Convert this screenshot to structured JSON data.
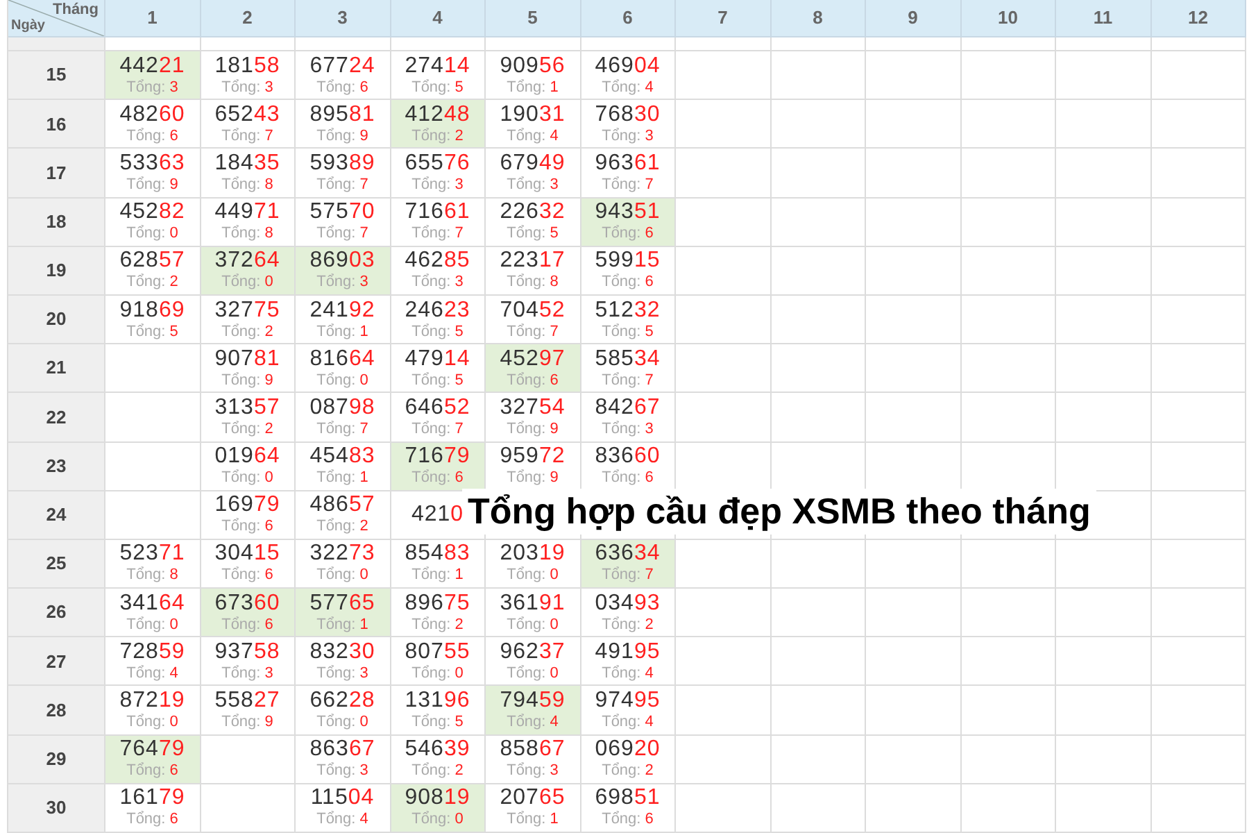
{
  "corner": {
    "column_label": "Tháng",
    "row_label": "Ngày"
  },
  "months": [
    "1",
    "2",
    "3",
    "4",
    "5",
    "6",
    "7",
    "8",
    "9",
    "10",
    "11",
    "12"
  ],
  "rows": [
    {
      "day": "15",
      "cells": [
        {
          "number": "44221",
          "total": "Tổng: 3",
          "highlighted": true
        },
        {
          "number": "18158",
          "total": "Tổng: 3",
          "highlighted": false
        },
        {
          "number": "67724",
          "total": "Tổng: 6",
          "highlighted": false
        },
        {
          "number": "27414",
          "total": "Tổng: 5",
          "highlighted": false
        },
        {
          "number": "90956",
          "total": "Tổng: 1",
          "highlighted": false
        },
        {
          "number": "46904",
          "total": "Tổng: 4",
          "highlighted": false
        }
      ]
    },
    {
      "day": "16",
      "cells": [
        {
          "number": "48260",
          "total": "Tổng: 6",
          "highlighted": false
        },
        {
          "number": "65243",
          "total": "Tổng: 7",
          "highlighted": false
        },
        {
          "number": "89581",
          "total": "Tổng: 9",
          "highlighted": false
        },
        {
          "number": "41248",
          "total": "Tổng: 2",
          "highlighted": true
        },
        {
          "number": "19031",
          "total": "Tổng: 4",
          "highlighted": false
        },
        {
          "number": "76830",
          "total": "Tổng: 3",
          "highlighted": false
        }
      ]
    },
    {
      "day": "17",
      "cells": [
        {
          "number": "53363",
          "total": "Tổng: 9",
          "highlighted": false
        },
        {
          "number": "18435",
          "total": "Tổng: 8",
          "highlighted": false
        },
        {
          "number": "59389",
          "total": "Tổng: 7",
          "highlighted": false
        },
        {
          "number": "65576",
          "total": "Tổng: 3",
          "highlighted": false
        },
        {
          "number": "67949",
          "total": "Tổng: 3",
          "highlighted": false
        },
        {
          "number": "96361",
          "total": "Tổng: 7",
          "highlighted": false
        }
      ]
    },
    {
      "day": "18",
      "cells": [
        {
          "number": "45282",
          "total": "Tổng: 0",
          "highlighted": false
        },
        {
          "number": "44971",
          "total": "Tổng: 8",
          "highlighted": false
        },
        {
          "number": "57570",
          "total": "Tổng: 7",
          "highlighted": false
        },
        {
          "number": "71661",
          "total": "Tổng: 7",
          "highlighted": false
        },
        {
          "number": "22632",
          "total": "Tổng: 5",
          "highlighted": false
        },
        {
          "number": "94351",
          "total": "Tổng: 6",
          "highlighted": true
        }
      ]
    },
    {
      "day": "19",
      "cells": [
        {
          "number": "62857",
          "total": "Tổng: 2",
          "highlighted": false
        },
        {
          "number": "37264",
          "total": "Tổng: 0",
          "highlighted": true
        },
        {
          "number": "86903",
          "total": "Tổng: 3",
          "highlighted": true
        },
        {
          "number": "46285",
          "total": "Tổng: 3",
          "highlighted": false
        },
        {
          "number": "22317",
          "total": "Tổng: 8",
          "highlighted": false
        },
        {
          "number": "59915",
          "total": "Tổng: 6",
          "highlighted": false
        }
      ]
    },
    {
      "day": "20",
      "cells": [
        {
          "number": "91869",
          "total": "Tổng: 5",
          "highlighted": false
        },
        {
          "number": "32775",
          "total": "Tổng: 2",
          "highlighted": false
        },
        {
          "number": "24192",
          "total": "Tổng: 1",
          "highlighted": false
        },
        {
          "number": "24623",
          "total": "Tổng: 5",
          "highlighted": false
        },
        {
          "number": "70452",
          "total": "Tổng: 7",
          "highlighted": false
        },
        {
          "number": "51232",
          "total": "Tổng: 5",
          "highlighted": false
        }
      ]
    },
    {
      "day": "21",
      "cells": [
        null,
        {
          "number": "90781",
          "total": "Tổng: 9",
          "highlighted": false
        },
        {
          "number": "81664",
          "total": "Tổng: 0",
          "highlighted": false
        },
        {
          "number": "47914",
          "total": "Tổng: 5",
          "highlighted": false
        },
        {
          "number": "45297",
          "total": "Tổng: 6",
          "highlighted": true
        },
        {
          "number": "58534",
          "total": "Tổng: 7",
          "highlighted": false
        }
      ]
    },
    {
      "day": "22",
      "cells": [
        null,
        {
          "number": "31357",
          "total": "Tổng: 2",
          "highlighted": false
        },
        {
          "number": "08798",
          "total": "Tổng: 7",
          "highlighted": false
        },
        {
          "number": "64652",
          "total": "Tổng: 7",
          "highlighted": false
        },
        {
          "number": "32754",
          "total": "Tổng: 9",
          "highlighted": false
        },
        {
          "number": "84267",
          "total": "Tổng: 3",
          "highlighted": false
        }
      ]
    },
    {
      "day": "23",
      "cells": [
        null,
        {
          "number": "01964",
          "total": "Tổng: 0",
          "highlighted": false
        },
        {
          "number": "45483",
          "total": "Tổng: 1",
          "highlighted": false
        },
        {
          "number": "71679",
          "total": "Tổng: 6",
          "highlighted": true
        },
        {
          "number": "95972",
          "total": "Tổng: 9",
          "highlighted": false
        },
        {
          "number": "83660",
          "total": "Tổng: 6",
          "highlighted": false
        }
      ]
    },
    {
      "day": "24",
      "cells": [
        null,
        {
          "number": "16979",
          "total": "Tổng: 6",
          "highlighted": false
        },
        {
          "number": "48657",
          "total": "Tổng: 2",
          "highlighted": false
        },
        {
          "number": "4210",
          "highlighted": false
        },
        null,
        null
      ]
    },
    {
      "day": "25",
      "cells": [
        {
          "number": "52371",
          "total": "Tổng: 8",
          "highlighted": false
        },
        {
          "number": "30415",
          "total": "Tổng: 6",
          "highlighted": false
        },
        {
          "number": "32273",
          "total": "Tổng: 0",
          "highlighted": false
        },
        {
          "number": "85483",
          "total": "Tổng: 1",
          "highlighted": false
        },
        {
          "number": "20319",
          "total": "Tổng: 0",
          "highlighted": false
        },
        {
          "number": "63634",
          "total": "Tổng: 7",
          "highlighted": true
        }
      ]
    },
    {
      "day": "26",
      "cells": [
        {
          "number": "34164",
          "total": "Tổng: 0",
          "highlighted": false
        },
        {
          "number": "67360",
          "total": "Tổng: 6",
          "highlighted": true
        },
        {
          "number": "57765",
          "total": "Tổng: 1",
          "highlighted": true
        },
        {
          "number": "89675",
          "total": "Tổng: 2",
          "highlighted": false
        },
        {
          "number": "36191",
          "total": "Tổng: 0",
          "highlighted": false
        },
        {
          "number": "03493",
          "total": "Tổng: 2",
          "highlighted": false
        }
      ]
    },
    {
      "day": "27",
      "cells": [
        {
          "number": "72859",
          "total": "Tổng: 4",
          "highlighted": false
        },
        {
          "number": "93758",
          "total": "Tổng: 3",
          "highlighted": false
        },
        {
          "number": "83230",
          "total": "Tổng: 3",
          "highlighted": false
        },
        {
          "number": "80755",
          "total": "Tổng: 0",
          "highlighted": false
        },
        {
          "number": "96237",
          "total": "Tổng: 0",
          "highlighted": false
        },
        {
          "number": "49195",
          "total": "Tổng: 4",
          "highlighted": false
        }
      ]
    },
    {
      "day": "28",
      "cells": [
        {
          "number": "87219",
          "total": "Tổng: 0",
          "highlighted": false
        },
        {
          "number": "55827",
          "total": "Tổng: 9",
          "highlighted": false
        },
        {
          "number": "66228",
          "total": "Tổng: 0",
          "highlighted": false
        },
        {
          "number": "13196",
          "total": "Tổng: 5",
          "highlighted": false
        },
        {
          "number": "79459",
          "total": "Tổng: 4",
          "highlighted": true
        },
        {
          "number": "97495",
          "total": "Tổng: 4",
          "highlighted": false
        }
      ]
    },
    {
      "day": "29",
      "cells": [
        {
          "number": "76479",
          "total": "Tổng: 6",
          "highlighted": true
        },
        null,
        {
          "number": "86367",
          "total": "Tổng: 3",
          "highlighted": false
        },
        {
          "number": "54639",
          "total": "Tổng: 2",
          "highlighted": false
        },
        {
          "number": "85867",
          "total": "Tổng: 3",
          "highlighted": false
        },
        {
          "number": "06920",
          "total": "Tổng: 2",
          "highlighted": false
        }
      ]
    },
    {
      "day": "30",
      "cells": [
        {
          "number": "16179",
          "total": "Tổng: 6",
          "highlighted": false
        },
        null,
        {
          "number": "11504",
          "total": "Tổng: 4",
          "highlighted": false
        },
        {
          "number": "90819",
          "total": "Tổng: 0",
          "highlighted": true
        },
        {
          "number": "20765",
          "total": "Tổng: 1",
          "highlighted": false
        },
        {
          "number": "69851",
          "total": "Tổng: 6",
          "highlighted": false
        }
      ]
    }
  ],
  "caption": "Tổng hợp cầu đẹp XSMB theo tháng"
}
